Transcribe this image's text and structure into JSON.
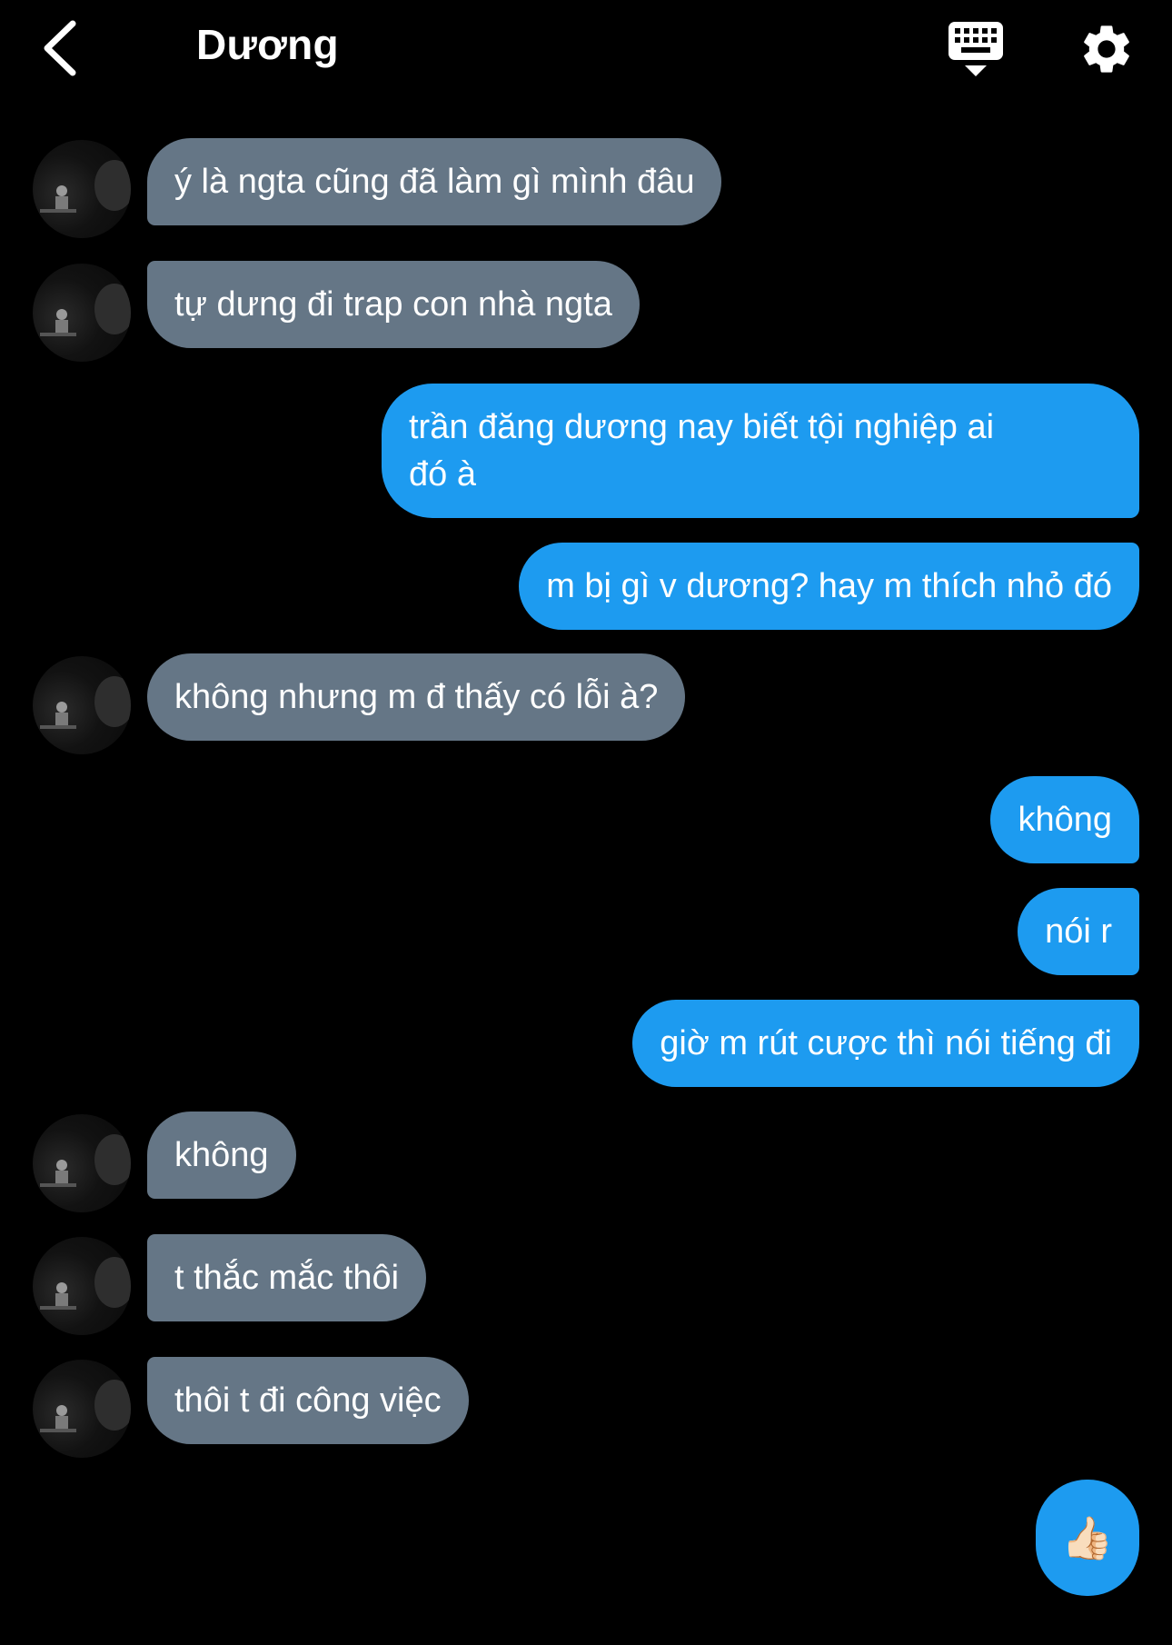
{
  "header": {
    "title": "Dương"
  },
  "icons": {
    "back": "chevron-left-icon",
    "keyboard": "keyboard-icon",
    "settings": "gear-icon"
  },
  "colors": {
    "incoming_bubble": "#657686",
    "outgoing_bubble": "#1d9bf0",
    "background": "#000000"
  },
  "messages": [
    {
      "direction": "in",
      "text": "ý là ngta cũng đã làm gì mình đâu"
    },
    {
      "direction": "in",
      "text": "tự dưng đi trap con nhà ngta"
    },
    {
      "direction": "out",
      "text": "trần đăng dương nay biết tội nghiệp ai\nđó à"
    },
    {
      "direction": "out",
      "text": "m bị gì v dương? hay m thích nhỏ đó"
    },
    {
      "direction": "in",
      "text": "không nhưng m đ thấy có lỗi à?"
    },
    {
      "direction": "out",
      "text": "không"
    },
    {
      "direction": "out",
      "text": "nói r"
    },
    {
      "direction": "out",
      "text": "giờ m rút cược thì nói tiếng đi"
    },
    {
      "direction": "in",
      "text": "không"
    },
    {
      "direction": "in",
      "text": "t thắc mắc thôi"
    },
    {
      "direction": "in",
      "text": "thôi t đi công việc"
    },
    {
      "direction": "out",
      "text": "👍🏻"
    }
  ]
}
